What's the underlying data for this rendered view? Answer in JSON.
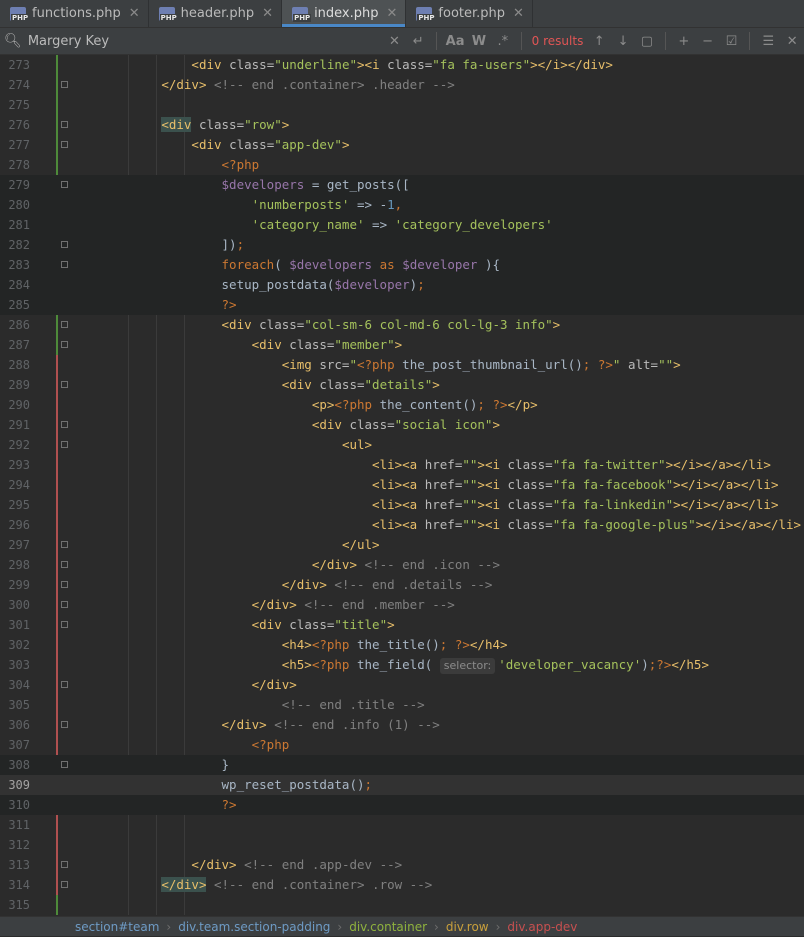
{
  "tabs": [
    {
      "label": "functions.php",
      "active": false
    },
    {
      "label": "header.php",
      "active": false
    },
    {
      "label": "index.php",
      "active": true
    },
    {
      "label": "footer.php",
      "active": false
    }
  ],
  "search": {
    "value": "Margery Key",
    "results": "0 results"
  },
  "editor": {
    "current_line": 309,
    "line_numbers": [
      "273",
      "274",
      "275",
      "276",
      "277",
      "278",
      "279",
      "280",
      "281",
      "282",
      "283",
      "284",
      "285",
      "286",
      "287",
      "288",
      "289",
      "290",
      "291",
      "292",
      "293",
      "294",
      "295",
      "296",
      "297",
      "298",
      "299",
      "300",
      "301",
      "302",
      "303",
      "304",
      "305",
      "306",
      "307",
      "308",
      "309",
      "310",
      "311",
      "312",
      "313",
      "314",
      "315"
    ],
    "hint": "selector:"
  },
  "breadcrumb": {
    "items": [
      {
        "label": "section#team",
        "color": "#6e9bc5"
      },
      {
        "label": "div.team.section-padding",
        "color": "#6e9bc5"
      },
      {
        "label": "div.container",
        "color": "#8fb23e"
      },
      {
        "label": "div.row",
        "color": "#c9a03c"
      },
      {
        "label": "div.app-dev",
        "color": "#c75050"
      }
    ]
  },
  "colors": {
    "tag": "#e8bf6a",
    "string": "#a5c25c",
    "comment": "#808080",
    "keyword": "#cc7832",
    "variable": "#9876aa",
    "active_tab_underline": "#4a88c7"
  }
}
